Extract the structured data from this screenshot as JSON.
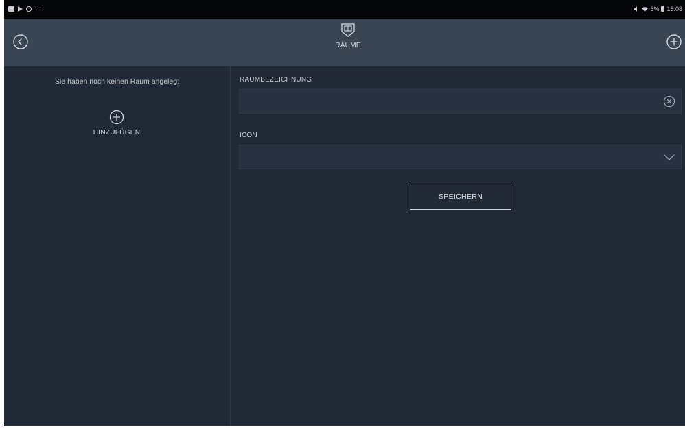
{
  "statusbar": {
    "left_icons": [
      "gallery-icon",
      "play-store-icon",
      "browser-icon",
      "more-icon"
    ],
    "ellipsis": "···",
    "right_text": "6%",
    "time": "16:08"
  },
  "header": {
    "title": "RÄUME",
    "back_icon": "back-circle-icon",
    "add_icon": "add-circle-icon",
    "room_icon": "room-door-icon"
  },
  "left_panel": {
    "empty_message": "Sie haben noch keinen Raum angelegt",
    "add_label": "HINZUFÜGEN"
  },
  "form": {
    "name_label": "RAUMBEZEICHNUNG",
    "name_value": "",
    "icon_label": "ICON",
    "icon_value": "",
    "save_label": "SPEICHERN"
  },
  "colors": {
    "background": "#212936",
    "header": "#3a4553",
    "text": "#c9cdd3"
  }
}
